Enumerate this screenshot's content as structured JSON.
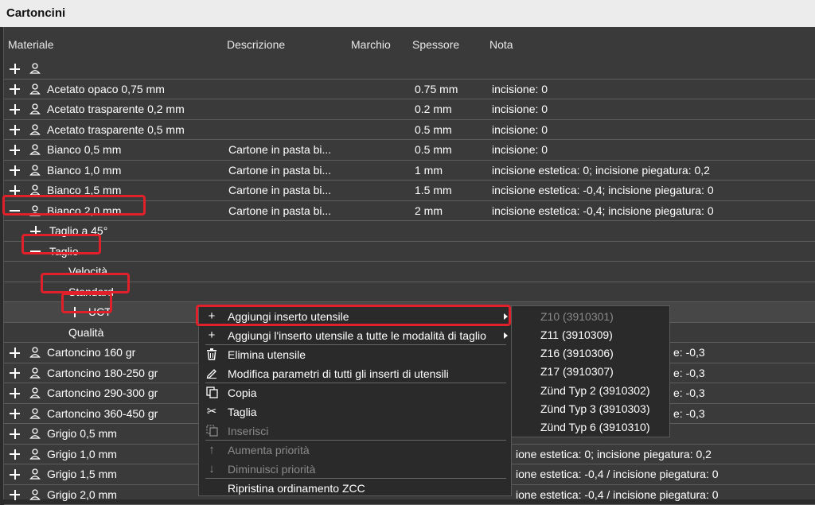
{
  "window": {
    "title": "Cartoncini"
  },
  "columns": {
    "materiale": "Materiale",
    "descrizione": "Descrizione",
    "marchio": "Marchio",
    "spessore": "Spessore",
    "nota": "Nota"
  },
  "rows": [
    {
      "expand": "plus",
      "name": "",
      "desc": "",
      "spessore": "",
      "nota": ""
    },
    {
      "expand": "plus",
      "name": "Acetato opaco 0,75 mm",
      "desc": "",
      "spessore": "0.75 mm",
      "nota": "incisione: 0"
    },
    {
      "expand": "plus",
      "name": "Acetato trasparente 0,2 mm",
      "desc": "",
      "spessore": "0.2 mm",
      "nota": "incisione: 0"
    },
    {
      "expand": "plus",
      "name": "Acetato trasparente 0,5 mm",
      "desc": "",
      "spessore": "0.5 mm",
      "nota": "incisione: 0"
    },
    {
      "expand": "plus",
      "name": "Bianco 0,5 mm",
      "desc": "Cartone in pasta bi...",
      "spessore": "0.5 mm",
      "nota": "incisione: 0"
    },
    {
      "expand": "plus",
      "name": "Bianco 1,0 mm",
      "desc": "Cartone in pasta bi...",
      "spessore": "1 mm",
      "nota": "incisione estetica: 0; incisione piegatura: 0,2"
    },
    {
      "expand": "plus",
      "name": "Bianco 1,5 mm",
      "desc": "Cartone in pasta bi...",
      "spessore": "1.5 mm",
      "nota": "incisione estetica: -0,4; incisione piegatura: 0"
    },
    {
      "expand": "minus",
      "name": "Bianco 2,0 mm",
      "desc": "Cartone in pasta bi...",
      "spessore": "2 mm",
      "nota": "incisione estetica: -0,4; incisione piegatura: 0"
    }
  ],
  "tree": {
    "taglio45": "Taglio a 45°",
    "taglio": "Taglio",
    "velocita": "Velocità",
    "standard": "Standard",
    "uct": "UCT",
    "qualita": "Qualità"
  },
  "lower_rows": [
    {
      "name": "Cartoncino 160 gr",
      "nota": "e: -0,3"
    },
    {
      "name": "Cartoncino 180-250 gr",
      "nota": "e: -0,3"
    },
    {
      "name": "Cartoncino 290-300 gr",
      "nota": "e: -0,3"
    },
    {
      "name": "Cartoncino 360-450 gr",
      "nota": "e: -0,3"
    },
    {
      "name": "Grigio 0,5 mm",
      "nota": ""
    },
    {
      "name": "Grigio 1,0 mm",
      "nota": "ione estetica: 0; incisione piegatura: 0,2"
    },
    {
      "name": "Grigio 1,5 mm",
      "nota": "ione estetica: -0,4 / incisione piegatura: 0"
    },
    {
      "name": "Grigio 2,0 mm",
      "nota": "ione estetica: -0,4 / incisione piegatura: 0"
    }
  ],
  "context_menu": {
    "items": [
      {
        "label": "Aggiungi inserto utensile",
        "icon": "plus-icon",
        "submenu": true,
        "disabled": false
      },
      {
        "label": "Aggiungi l'inserto utensile a tutte le modalità di taglio",
        "icon": "plus-icon",
        "submenu": true,
        "disabled": false
      },
      {
        "label": "Elimina utensile",
        "icon": "trash-icon",
        "submenu": false,
        "disabled": false
      },
      {
        "label": "Modifica parametri di tutti gli inserti di utensili",
        "icon": "pencil-icon",
        "submenu": false,
        "disabled": false
      },
      {
        "label": "Copia",
        "icon": "copy-icon",
        "submenu": false,
        "disabled": false
      },
      {
        "label": "Taglia",
        "icon": "scissors-icon",
        "submenu": false,
        "disabled": false
      },
      {
        "label": "Inserisci",
        "icon": "paste-icon",
        "submenu": false,
        "disabled": true
      },
      {
        "label": "Aumenta priorità",
        "icon": "arrow-up-icon",
        "submenu": false,
        "disabled": true
      },
      {
        "label": "Diminuisci priorità",
        "icon": "arrow-down-icon",
        "submenu": false,
        "disabled": true
      },
      {
        "label": "Ripristina ordinamento ZCC",
        "icon": "",
        "submenu": false,
        "disabled": false
      }
    ]
  },
  "submenu": {
    "items": [
      {
        "label": "Z10 (3910301)",
        "disabled": true
      },
      {
        "label": "Z11 (3910309)",
        "disabled": false
      },
      {
        "label": "Z16 (3910306)",
        "disabled": false
      },
      {
        "label": "Z17 (3910307)",
        "disabled": false
      },
      {
        "label": "Zünd Typ 2 (3910302)",
        "disabled": false
      },
      {
        "label": "Zünd Typ 3 (3910303)",
        "disabled": false
      },
      {
        "label": "Zünd Typ 6 (3910310)",
        "disabled": false
      }
    ]
  },
  "colors": {
    "highlight": "#e0202a",
    "background": "#3a3a3a",
    "title_bg": "#ececec"
  }
}
